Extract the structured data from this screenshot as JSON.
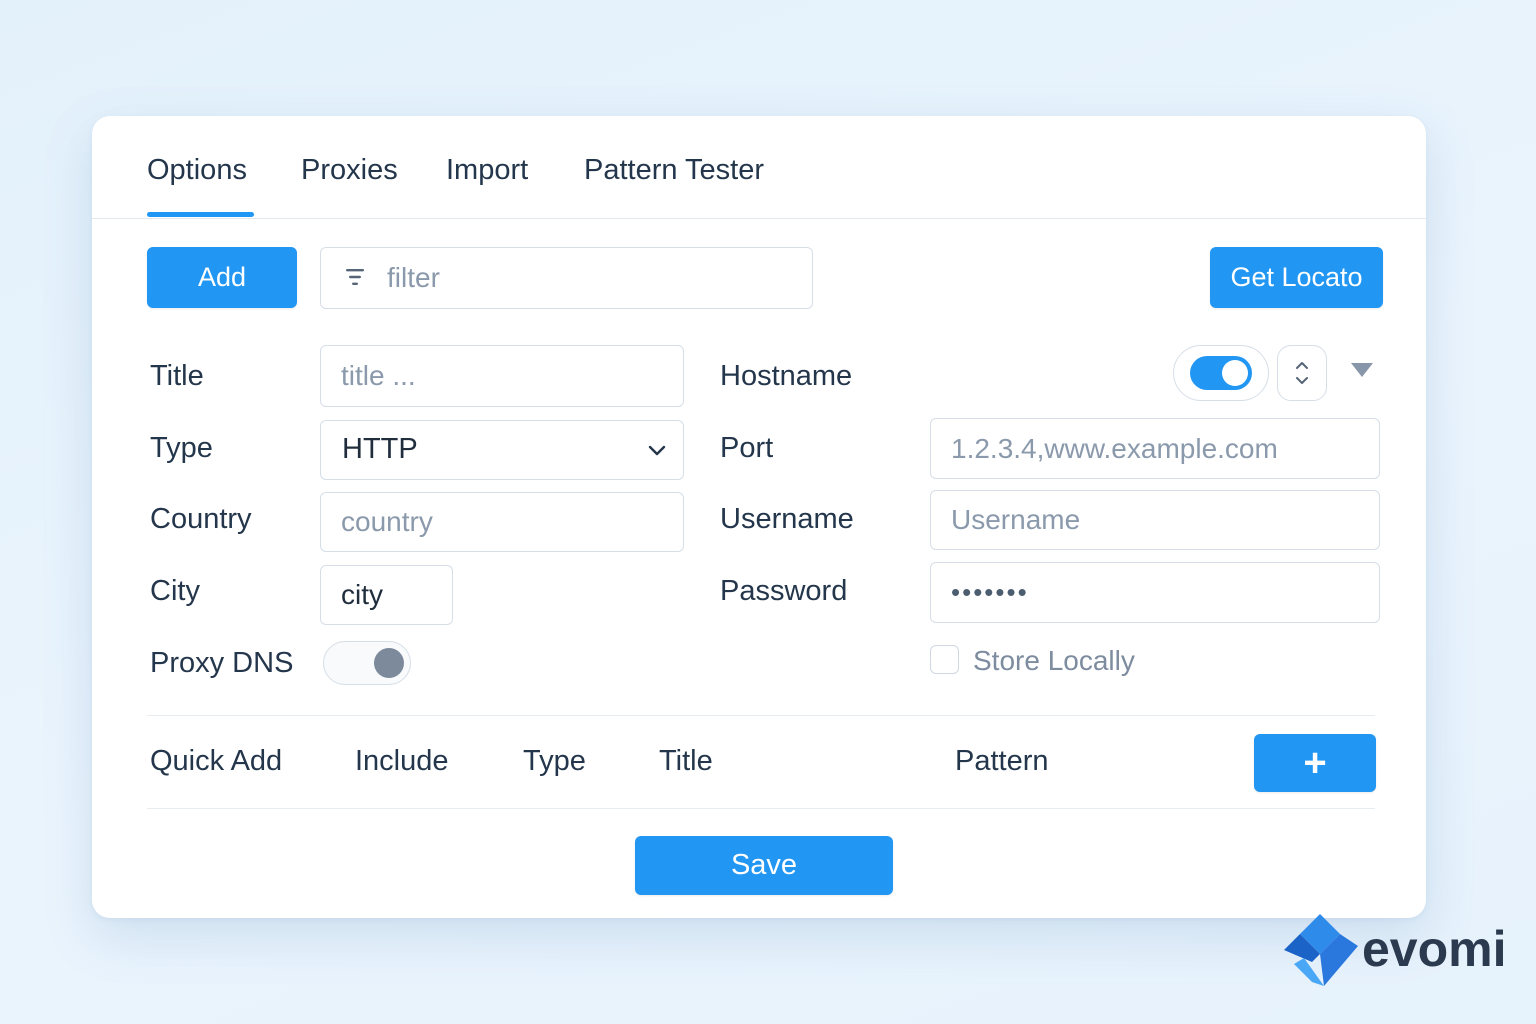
{
  "tabs": [
    {
      "label": "Options",
      "active": true
    },
    {
      "label": "Proxies"
    },
    {
      "label": "Import"
    },
    {
      "label": "Pattern Tester"
    }
  ],
  "toolbar": {
    "add_label": "Add",
    "filter_placeholder": "filter",
    "locate_label": "Get Locato"
  },
  "form": {
    "title_label": "Title",
    "title_placeholder": "title ...",
    "type_label": "Type",
    "type_value": "HTTP",
    "country_label": "Country",
    "country_placeholder": "country",
    "city_label": "City",
    "city_value": "city",
    "proxy_dns_label": "Proxy DNS",
    "proxy_dns_enabled": false,
    "hostname_label": "Hostname",
    "hostname_enabled": true,
    "port_label": "Port",
    "port_placeholder": "1.2.3.4,www.example.com",
    "username_label": "Username",
    "username_placeholder": "Username",
    "password_label": "Password",
    "password_value": "•••••••",
    "store_locally_label": "Store Locally",
    "store_locally_checked": false
  },
  "quick_add": {
    "label": "Quick Add",
    "columns": [
      "Include",
      "Type",
      "Title",
      "Pattern"
    ],
    "add_label": "+"
  },
  "save_label": "Save",
  "brand": {
    "name": "evomi",
    "accent": "#2196f3"
  }
}
